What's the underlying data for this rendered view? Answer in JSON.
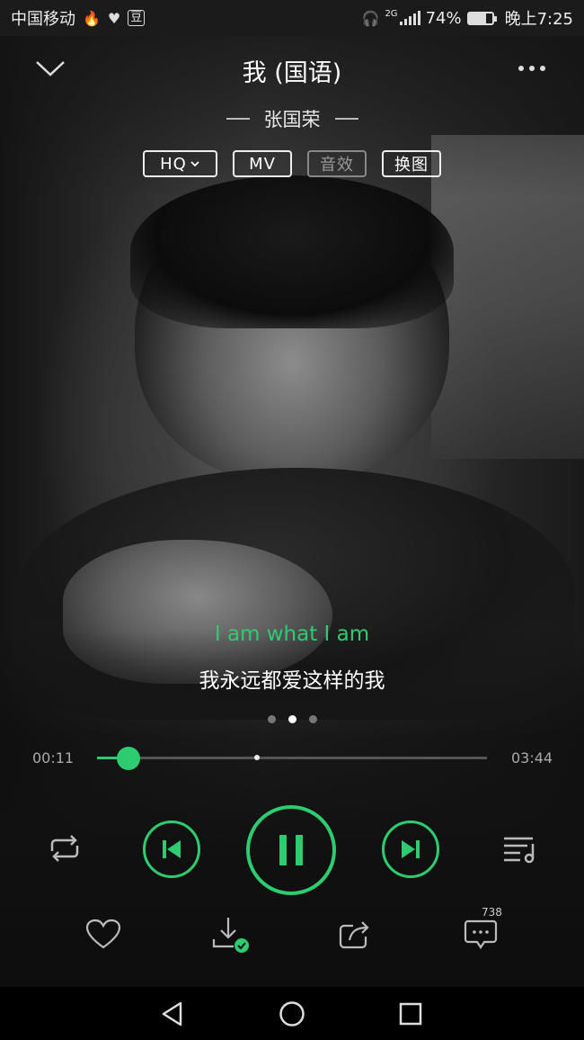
{
  "status_bar": {
    "carrier": "中国移动",
    "app_badge": "豆",
    "network": "2G",
    "battery_percent": "74%",
    "battery_level": 0.74,
    "time": "晚上7:25"
  },
  "header": {
    "song_title": "我 (国语)",
    "artist": "张国荣",
    "tags": {
      "quality": "HQ",
      "mv": "MV",
      "effects": "音效",
      "swap_image": "换图"
    }
  },
  "lyrics": {
    "current_line_en": "I am what I am",
    "current_line_cn": "我永远都爱这样的我"
  },
  "pager": {
    "count": 3,
    "active_index": 1
  },
  "progress": {
    "current": "00:11",
    "total": "03:44",
    "played_fraction": 0.08,
    "buffered_fraction": 0.41
  },
  "actions": {
    "comment_count": "738"
  },
  "colors": {
    "accent": "#2ecc71",
    "status_bar": "#1b1b1b",
    "background": "#111111"
  },
  "icons": {
    "back": "chevron-down-icon",
    "more": "more-icon",
    "loop": "repeat-icon",
    "prev": "skip-previous-icon",
    "play": "pause-icon",
    "next": "skip-next-icon",
    "list": "playlist-icon",
    "like": "heart-icon",
    "download": "download-icon",
    "share": "share-icon",
    "comment": "comment-icon"
  }
}
